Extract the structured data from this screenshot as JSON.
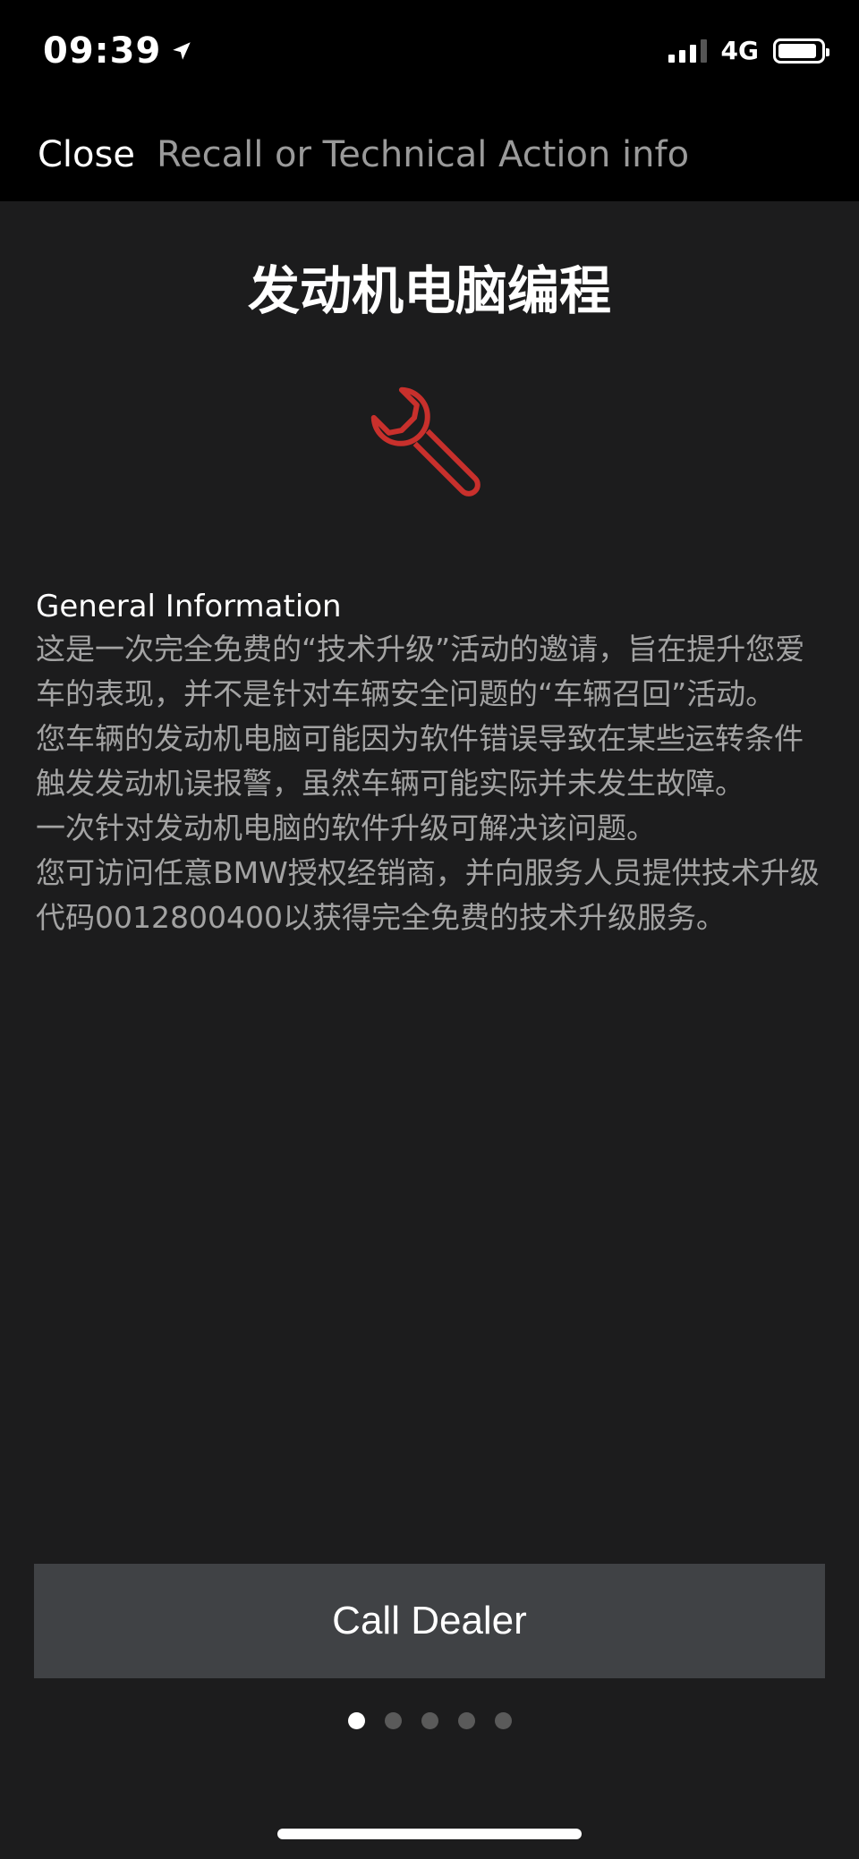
{
  "status_bar": {
    "time": "09:39",
    "network": "4G",
    "signal_bars_active": 3,
    "signal_bars_total": 4,
    "battery_level_fraction": 0.85,
    "location_icon": "location-arrow-icon"
  },
  "nav": {
    "close_label": "Close",
    "title": "Recall or Technical Action info"
  },
  "page": {
    "title": "发动机电脑编程",
    "icon": "wrench-icon",
    "icon_color": "#c8302c"
  },
  "info": {
    "heading": "General Information",
    "paragraphs": [
      "这是一次完全免费的“技术升级”活动的邀请，旨在提升您爱车的表现，并不是针对车辆安全问题的“车辆召回”活动。",
      "您车辆的发动机电脑可能因为软件错误导致在某些运转条件触发发动机误报警，虽然车辆可能实际并未发生故障。",
      "一次针对发动机电脑的软件升级可解决该问题。",
      "您可访问任意BMW授权经销商，并向服务人员提供技术升级代码0012800400以获得完全免费的技术升级服务。"
    ]
  },
  "actions": {
    "call_dealer_label": "Call Dealer"
  },
  "pagination": {
    "total": 5,
    "current": 1
  },
  "colors": {
    "background": "#1c1c1d",
    "bar_background": "#000000",
    "button_background": "#404245",
    "secondary_text": "#a3a3a3",
    "accent": "#c8302c"
  }
}
